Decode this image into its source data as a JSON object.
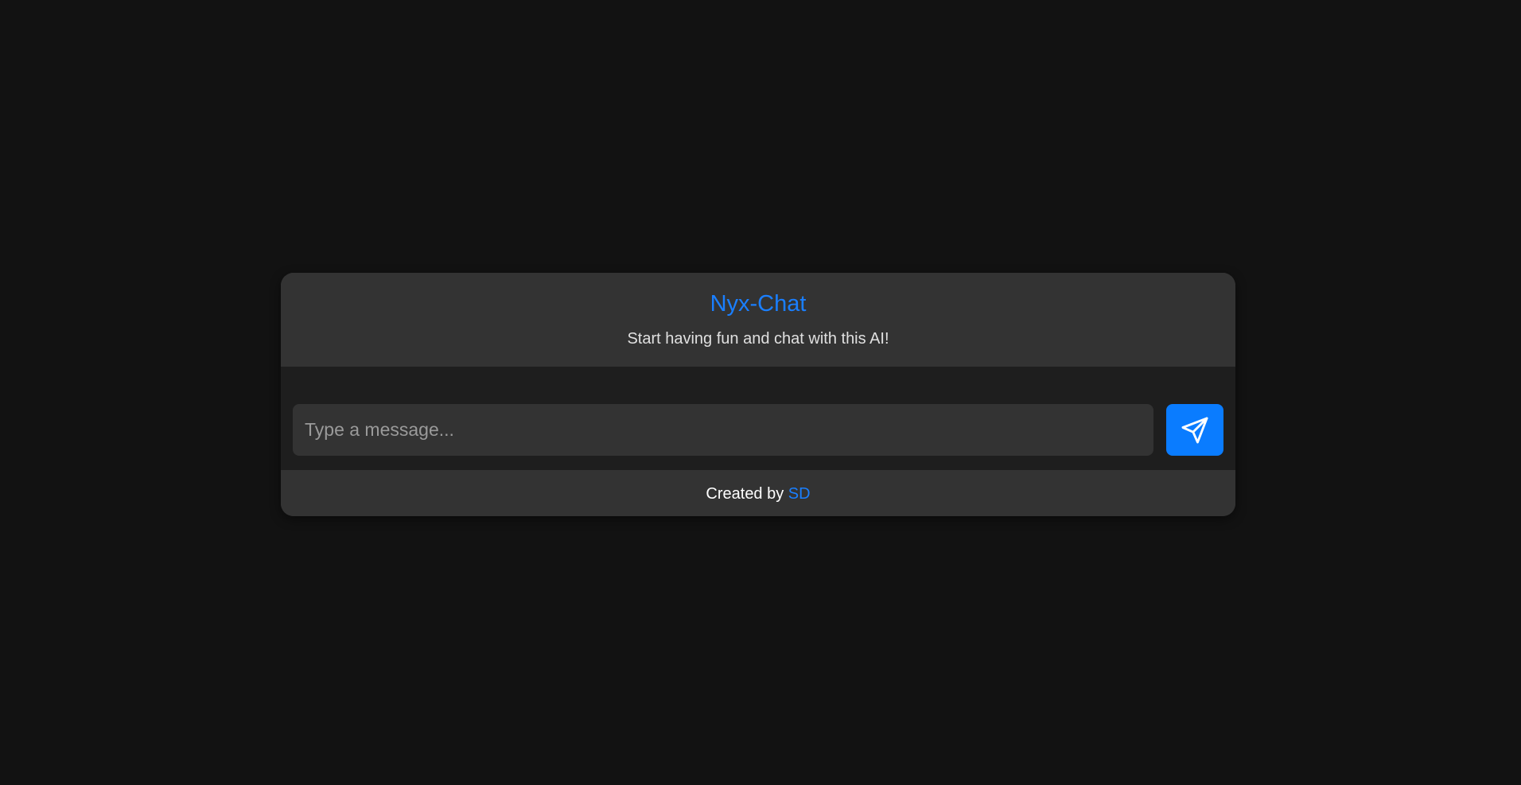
{
  "header": {
    "title": "Nyx-Chat",
    "subtitle": "Start having fun and chat with this AI!"
  },
  "input": {
    "placeholder": "Type a message...",
    "value": ""
  },
  "send_button": {
    "icon": "send-icon"
  },
  "footer": {
    "prefix": "Created by ",
    "author": "SD"
  },
  "colors": {
    "page_background": "#121212",
    "card_background": "#333333",
    "input_area_background": "#1e1e1e",
    "accent": "#0a7cff"
  }
}
